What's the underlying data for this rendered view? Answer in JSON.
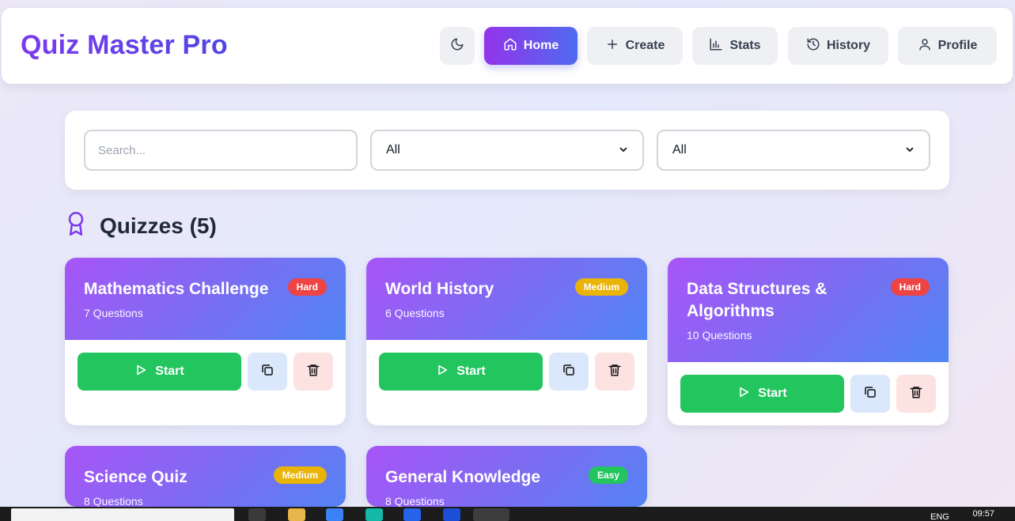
{
  "app": {
    "title": "Quiz Master Pro"
  },
  "nav": {
    "theme_toggle_icon": "moon-icon",
    "items": [
      {
        "label": "Home",
        "icon": "home-icon",
        "active": true
      },
      {
        "label": "Create",
        "icon": "plus-icon",
        "active": false
      },
      {
        "label": "Stats",
        "icon": "bar-chart-icon",
        "active": false
      },
      {
        "label": "History",
        "icon": "history-icon",
        "active": false
      },
      {
        "label": "Profile",
        "icon": "user-icon",
        "active": false
      }
    ]
  },
  "filters": {
    "search_placeholder": "Search...",
    "category_value": "All",
    "difficulty_value": "All"
  },
  "section": {
    "title": "Quizzes (5)",
    "icon": "award-icon"
  },
  "quizzes": [
    {
      "title": "Mathematics Challenge",
      "questions": "7 Questions",
      "difficulty": "Hard"
    },
    {
      "title": "World History",
      "questions": "6 Questions",
      "difficulty": "Medium"
    },
    {
      "title": "Data Structures & Algorithms",
      "questions": "10 Questions",
      "difficulty": "Hard"
    },
    {
      "title": "Science Quiz",
      "questions": "8 Questions",
      "difficulty": "Medium"
    },
    {
      "title": "General Knowledge",
      "questions": "8 Questions",
      "difficulty": "Easy"
    }
  ],
  "card_actions": {
    "start_label": "Start",
    "copy_icon": "copy-icon",
    "delete_icon": "trash-icon"
  },
  "colors": {
    "accent_start": "#9333ea",
    "accent_end": "#4f6bf0",
    "start_button": "#22c55e",
    "hard": "#ef4444",
    "medium": "#eab308",
    "easy": "#22c55e"
  },
  "taskbar": {
    "clock": "09:57",
    "language": "ENG"
  }
}
